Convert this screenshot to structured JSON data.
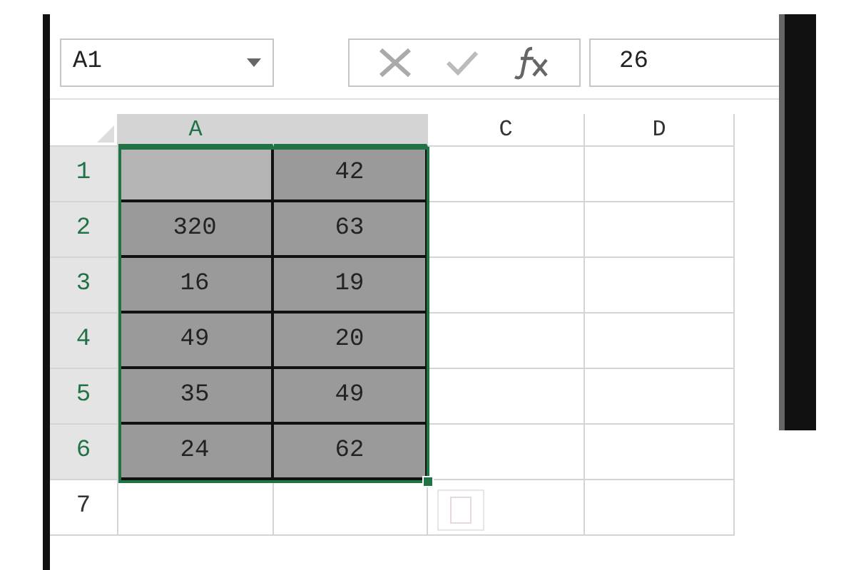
{
  "name_box": {
    "value": "A1"
  },
  "formula_bar": {
    "value": "26"
  },
  "columns": [
    {
      "label": "A",
      "selected": true
    },
    {
      "selected": true
    },
    {
      "label": "C",
      "selected": false
    },
    {
      "label": "D",
      "selected": false
    }
  ],
  "rows": [
    {
      "label": "1",
      "selected": true,
      "cells": [
        {
          "selected": true,
          "active": true
        },
        {
          "value": "42",
          "selected": true,
          "active": false
        },
        {
          "selected": false,
          "active": false
        },
        {
          "selected": false,
          "active": false
        }
      ]
    },
    {
      "label": "2",
      "selected": true,
      "cells": [
        {
          "value": "320",
          "selected": true,
          "active": false
        },
        {
          "value": "63",
          "selected": true,
          "active": false
        },
        {
          "selected": false,
          "active": false
        },
        {
          "selected": false,
          "active": false
        }
      ]
    },
    {
      "label": "3",
      "selected": true,
      "cells": [
        {
          "value": "16",
          "selected": true,
          "active": false
        },
        {
          "value": "19",
          "selected": true,
          "active": false
        },
        {
          "selected": false,
          "active": false
        },
        {
          "selected": false,
          "active": false
        }
      ]
    },
    {
      "label": "4",
      "selected": true,
      "cells": [
        {
          "value": "49",
          "selected": true,
          "active": false
        },
        {
          "value": "20",
          "selected": true,
          "active": false
        },
        {
          "selected": false,
          "active": false
        },
        {
          "selected": false,
          "active": false
        }
      ]
    },
    {
      "label": "5",
      "selected": true,
      "cells": [
        {
          "value": "35",
          "selected": true,
          "active": false
        },
        {
          "value": "49",
          "selected": true,
          "active": false
        },
        {
          "selected": false,
          "active": false
        },
        {
          "selected": false,
          "active": false
        }
      ]
    },
    {
      "label": "6",
      "selected": true,
      "cells": [
        {
          "value": "24",
          "selected": true,
          "active": false
        },
        {
          "value": "62",
          "selected": true,
          "active": false
        },
        {
          "selected": false,
          "active": false
        },
        {
          "selected": false,
          "active": false
        }
      ]
    },
    {
      "label": "7",
      "selected": false,
      "cells": [
        {
          "selected": false,
          "active": false
        },
        {
          "selected": false,
          "active": false
        },
        {
          "selected": false,
          "active": false
        },
        {
          "selected": false,
          "active": false
        }
      ]
    }
  ]
}
